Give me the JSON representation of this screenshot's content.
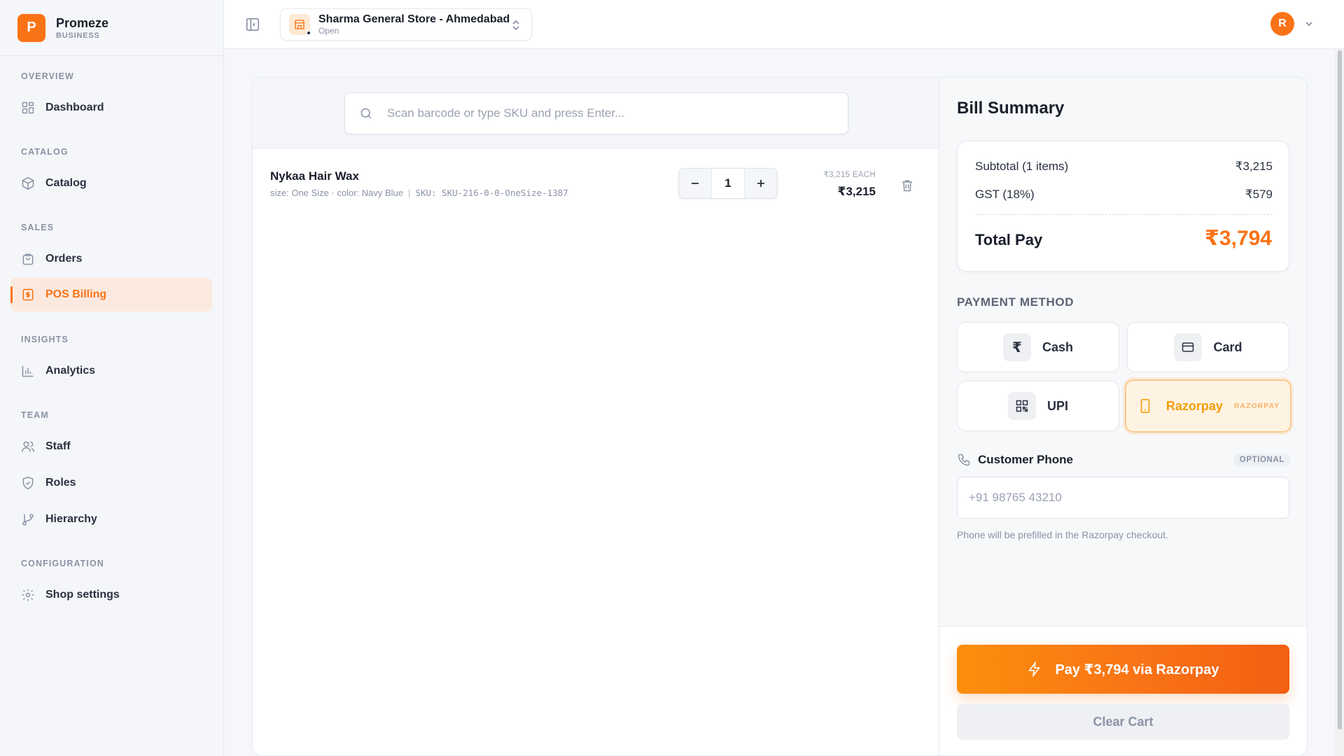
{
  "brand": {
    "logo_letter": "P",
    "name": "Promeze",
    "sub": "BUSINESS"
  },
  "sidebar": {
    "sections": [
      {
        "label": "OVERVIEW"
      },
      {
        "label": "CATALOG"
      },
      {
        "label": "SALES"
      },
      {
        "label": "INSIGHTS"
      },
      {
        "label": "TEAM"
      },
      {
        "label": "CONFIGURATION"
      }
    ],
    "items": [
      {
        "label": "Dashboard",
        "icon": "dashboard-icon"
      },
      {
        "label": "Catalog",
        "icon": "box-icon"
      },
      {
        "label": "Orders",
        "icon": "bag-icon"
      },
      {
        "label": "POS Billing",
        "icon": "receipt-icon",
        "active": true
      },
      {
        "label": "Analytics",
        "icon": "bar-chart-icon"
      },
      {
        "label": "Staff",
        "icon": "users-icon"
      },
      {
        "label": "Roles",
        "icon": "shield-icon"
      },
      {
        "label": "Hierarchy",
        "icon": "git-branch-icon"
      },
      {
        "label": "Shop settings",
        "icon": "gear-icon"
      }
    ]
  },
  "topbar": {
    "store": {
      "name": "Sharma General Store - Ahmedabad",
      "status": "Open"
    },
    "avatar_initial": "R"
  },
  "search": {
    "placeholder": "Scan barcode or type SKU and press Enter...",
    "value": ""
  },
  "cart": {
    "items": [
      {
        "name": "Nykaa Hair Wax",
        "variant": "size: One Size · color: Navy Blue",
        "sep": "|",
        "sku": "SKU: SKU-216-0-0-OneSize-1387",
        "qty": "1",
        "price_each": "₹3,215 EACH",
        "line_total": "₹3,215"
      }
    ]
  },
  "summary": {
    "title": "Bill Summary",
    "subtotal_label": "Subtotal (1 items)",
    "subtotal_value": "₹3,215",
    "gst_label": "GST (18%)",
    "gst_value": "₹579",
    "total_label": "Total Pay",
    "total_value": "₹3,794"
  },
  "payment": {
    "title": "PAYMENT METHOD",
    "methods": [
      {
        "label": "Cash",
        "icon": "rupee-icon"
      },
      {
        "label": "Card",
        "icon": "credit-card-icon"
      },
      {
        "label": "UPI",
        "icon": "qr-code-icon"
      },
      {
        "label": "Razorpay",
        "icon": "smartphone-icon",
        "tag": "RAZORPAY",
        "selected": true
      }
    ]
  },
  "customer_phone": {
    "label": "Customer Phone",
    "badge": "OPTIONAL",
    "placeholder": "+91 98765 43210",
    "value": "",
    "hint": "Phone will be prefilled in the Razorpay checkout."
  },
  "actions": {
    "pay_label": "Pay ₹3,794 via Razorpay",
    "clear_label": "Clear Cart"
  },
  "colors": {
    "accent": "#f97316",
    "selected_bg": "#fef3e2",
    "amber": "#f59e0b"
  }
}
